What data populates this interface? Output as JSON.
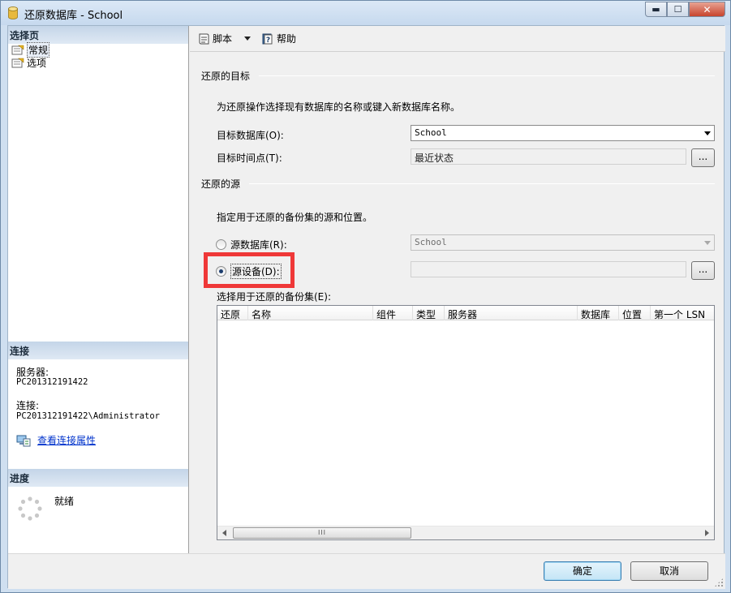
{
  "window": {
    "title": "还原数据库 - School",
    "controls": {
      "minimize": "▬",
      "maximize": "☐",
      "close": "✕"
    }
  },
  "left": {
    "select_page": {
      "header": "选择页",
      "items": [
        {
          "label": "常规",
          "selected": true
        },
        {
          "label": "选项",
          "selected": false
        }
      ]
    },
    "connection": {
      "header": "连接",
      "server_label": "服务器:",
      "server_value": "PC201312191422",
      "conn_label": "连接:",
      "conn_value": "PC201312191422\\Administrator",
      "view_link": "查看连接属性"
    },
    "progress": {
      "header": "进度",
      "status": "就绪"
    }
  },
  "toolbar": {
    "script_label": "脚本",
    "help_label": "帮助"
  },
  "target": {
    "group_label": "还原的目标",
    "description": "为还原操作选择现有数据库的名称或键入新数据库名称。",
    "db_label": "目标数据库(O):",
    "db_value": "School",
    "time_label": "目标时间点(T):",
    "time_value": "最近状态",
    "browse_label": "..."
  },
  "source": {
    "group_label": "还原的源",
    "description": "指定用于还原的备份集的源和位置。",
    "from_db_label": "源数据库(R):",
    "from_db_value": "School",
    "from_device_label": "源设备(D):",
    "device_value": "",
    "browse_label": "...",
    "selected": "device"
  },
  "backup_sets": {
    "label": "选择用于还原的备份集(E):",
    "columns": [
      "还原",
      "名称",
      "组件",
      "类型",
      "服务器",
      "数据库",
      "位置",
      "第一个 LSN"
    ],
    "rows": [],
    "scroll_grip": "III"
  },
  "buttons": {
    "ok": "确定",
    "cancel": "取消"
  },
  "colors": {
    "highlight": "#ef3838",
    "section_header": "#c4d5e8",
    "link": "#0033cc"
  }
}
